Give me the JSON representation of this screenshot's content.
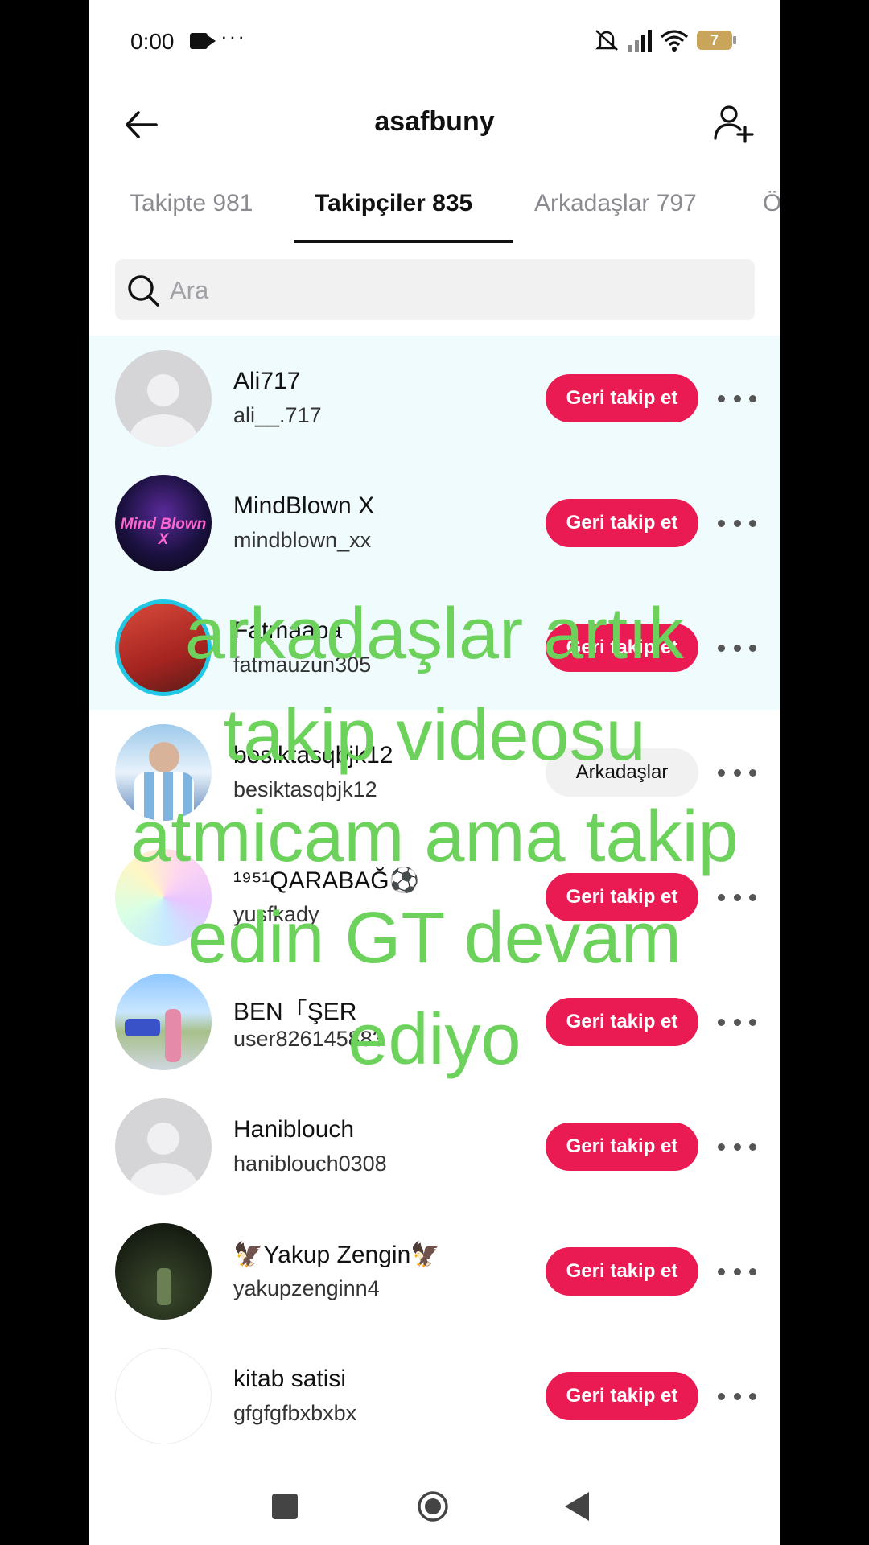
{
  "status_bar": {
    "time": "0:00",
    "battery": "7"
  },
  "header": {
    "title": "asafbuny"
  },
  "tabs": [
    {
      "label": "Takipte 981",
      "active": false
    },
    {
      "label": "Takipçiler 835",
      "active": true
    },
    {
      "label": "Arkadaşlar 797",
      "active": false
    },
    {
      "label": "Ö",
      "active": false
    }
  ],
  "search": {
    "placeholder": "Ara"
  },
  "users": [
    {
      "name": "Ali717",
      "handle": "ali__.717",
      "button": "Geri takip et"
    },
    {
      "name": "MindBlown X",
      "handle": "mindblown_xx",
      "button": "Geri takip et",
      "avatar_text": "Mind Blown X"
    },
    {
      "name": "Fatmaapa",
      "handle": "fatmauzun305",
      "button": "Geri takip et"
    },
    {
      "name": "besiktasqbjk12",
      "handle": "besiktasqbjk12",
      "button": "Arkadaşlar"
    },
    {
      "name": "¹⁹⁵¹QARABAĞ⚽",
      "handle": "yusfkady",
      "button": "Geri takip et"
    },
    {
      "name": "BEN「ŞER",
      "handle": "user826145883",
      "button": "Geri takip et"
    },
    {
      "name": "Haniblouch",
      "handle": "haniblouch0308",
      "button": "Geri takip et"
    },
    {
      "name": "🦅Yakup Zengin🦅",
      "handle": "yakupzenginn4",
      "button": "Geri takip et"
    },
    {
      "name": "kitab satisi",
      "handle": "gfgfgfbxbxbx",
      "button": "Geri takip et"
    }
  ],
  "overlay_caption": "arkadaşlar artık takip videosu atmicam ama takip edin GT devam ediyo",
  "colors": {
    "accent": "#ea1b53",
    "caption": "#6cd25c",
    "highlight_row": "#f0fbfe"
  },
  "icons": [
    "back-arrow-icon",
    "add-user-icon",
    "search-icon",
    "more-icon",
    "nav-square-icon",
    "nav-home-icon",
    "nav-back-icon"
  ]
}
